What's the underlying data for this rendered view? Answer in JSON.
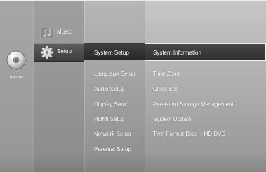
{
  "disc": {
    "label": "No Disc",
    "icon": "disc-icon"
  },
  "categories": [
    {
      "label": "Music",
      "icon": "music-note-icon",
      "selected": false
    },
    {
      "label": "Setup",
      "icon": "gear-icon",
      "selected": true
    }
  ],
  "submenu": {
    "selected": "System Setup",
    "items": [
      "System Setup",
      "Language Setup",
      "Audio Setup",
      "Display Setup",
      "HDMI Setup",
      "Network Setup",
      "Parental Setup"
    ]
  },
  "options": {
    "selected": "System Information",
    "items": [
      {
        "label": "System Information",
        "value": null
      },
      {
        "label": "Time Zone",
        "value": null
      },
      {
        "label": "Clock Set",
        "value": null
      },
      {
        "label": "Persistent Storage Management",
        "value": null
      },
      {
        "label": "System Update",
        "value": null
      },
      {
        "label": "Twin Format Disc",
        "value": ":   HD DVD"
      }
    ]
  },
  "colors": {
    "text": "#ffffff",
    "selection_fill": "#333333",
    "selection_border": "#f2f2f2"
  }
}
